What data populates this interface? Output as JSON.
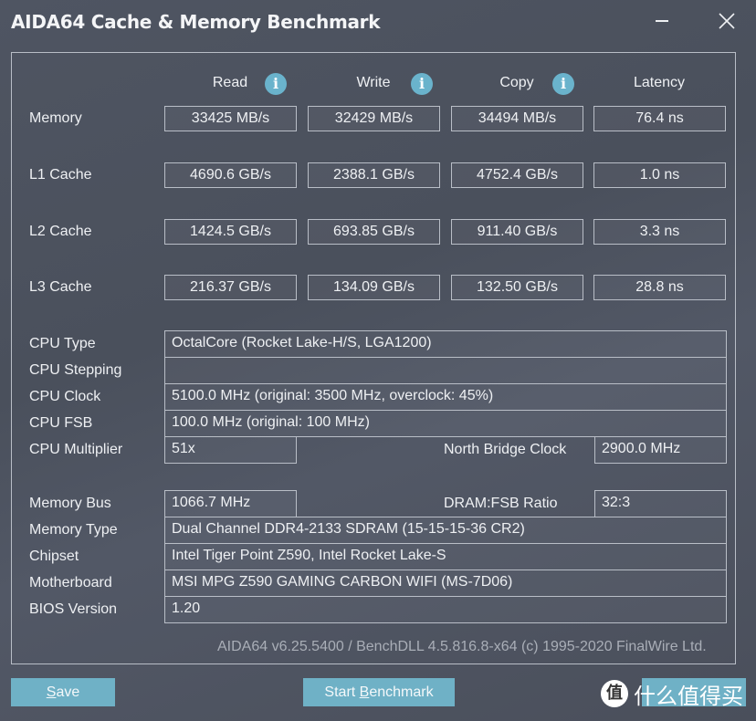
{
  "window": {
    "title": "AIDA64 Cache & Memory Benchmark",
    "minimize_icon": "minimize-icon",
    "close_icon": "close-icon"
  },
  "columns": [
    {
      "label": "Read",
      "info_icon": "i"
    },
    {
      "label": "Write",
      "info_icon": "i"
    },
    {
      "label": "Copy",
      "info_icon": "i"
    },
    {
      "label": "Latency"
    }
  ],
  "benchmarks": [
    {
      "label": "Memory",
      "read": "33425 MB/s",
      "write": "32429 MB/s",
      "copy": "34494 MB/s",
      "latency": "76.4 ns"
    },
    {
      "label": "L1 Cache",
      "read": "4690.6 GB/s",
      "write": "2388.1 GB/s",
      "copy": "4752.4 GB/s",
      "latency": "1.0 ns"
    },
    {
      "label": "L2 Cache",
      "read": "1424.5 GB/s",
      "write": "693.85 GB/s",
      "copy": "911.40 GB/s",
      "latency": "3.3 ns"
    },
    {
      "label": "L3 Cache",
      "read": "216.37 GB/s",
      "write": "134.09 GB/s",
      "copy": "132.50 GB/s",
      "latency": "28.8 ns"
    }
  ],
  "system": {
    "cpu_type": {
      "label": "CPU Type",
      "value": "OctalCore   (Rocket Lake-H/S, LGA1200)"
    },
    "cpu_stepping": {
      "label": "CPU Stepping",
      "value": ""
    },
    "cpu_clock": {
      "label": "CPU Clock",
      "value": "5100.0 MHz  (original: 3500 MHz, overclock: 45%)"
    },
    "cpu_fsb": {
      "label": "CPU FSB",
      "value": "100.0 MHz  (original: 100 MHz)"
    },
    "cpu_multiplier": {
      "label": "CPU Multiplier",
      "value": "51x"
    },
    "north_bridge_clock": {
      "label": "North Bridge Clock",
      "value": "2900.0 MHz"
    },
    "memory_bus": {
      "label": "Memory Bus",
      "value": "1066.7 MHz"
    },
    "dram_fsb_ratio": {
      "label": "DRAM:FSB Ratio",
      "value": "32:3"
    },
    "memory_type": {
      "label": "Memory Type",
      "value": "Dual Channel DDR4-2133 SDRAM  (15-15-15-36 CR2)"
    },
    "chipset": {
      "label": "Chipset",
      "value": "Intel Tiger Point Z590, Intel Rocket Lake-S"
    },
    "motherboard": {
      "label": "Motherboard",
      "value": "MSI MPG Z590 GAMING CARBON WIFI (MS-7D06)"
    },
    "bios_version": {
      "label": "BIOS Version",
      "value": "1.20"
    }
  },
  "footer": "AIDA64 v6.25.5400 / BenchDLL 4.5.816.8-x64  (c) 1995-2020 FinalWire Ltd.",
  "buttons": {
    "save_pre": "",
    "save_ul": "S",
    "save_post": "ave",
    "start_pre": "Start ",
    "start_ul": "B",
    "start_post": "enchmark"
  },
  "watermark": {
    "badge": "值",
    "text": "什么值得买"
  },
  "colors": {
    "accent": "#6fb1c6",
    "info": "#6ab3cc",
    "background": "#4d525e",
    "border": "#b9bec7"
  }
}
